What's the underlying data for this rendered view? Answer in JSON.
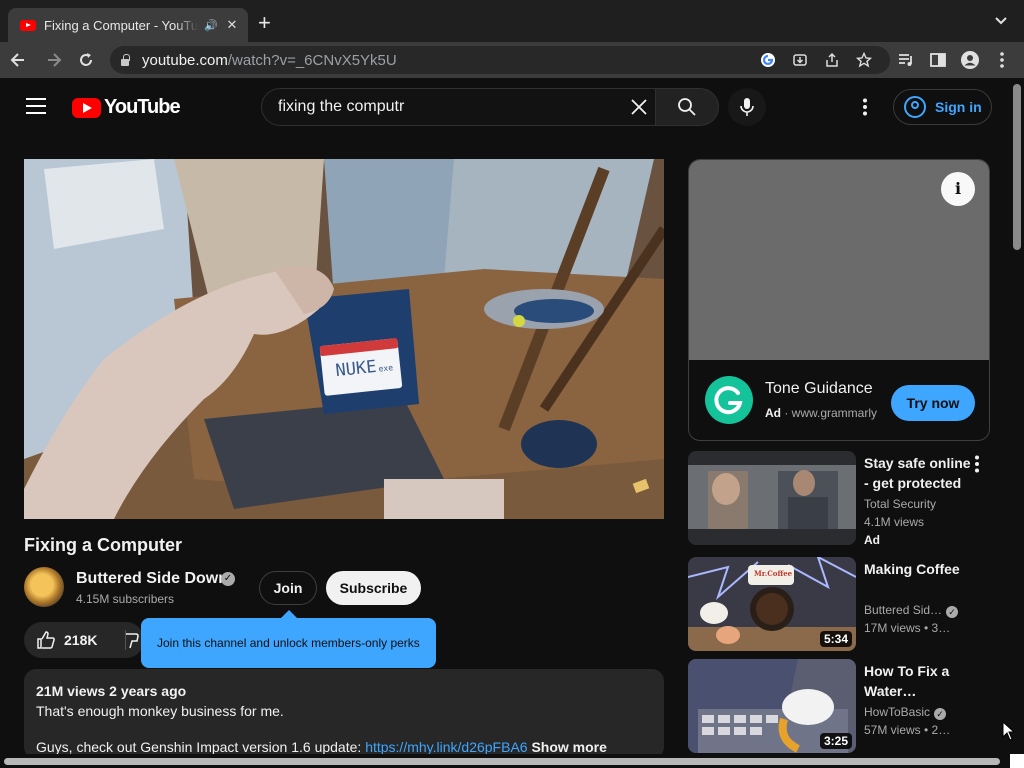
{
  "browser": {
    "tab_title": "Fixing a Computer - YouTube",
    "url_host": "youtube.com",
    "url_path": "/watch?v=_6CNvX5Yk5U"
  },
  "header": {
    "logo_text": "YouTube",
    "search_value": "fixing the computr",
    "sign_in_label": "Sign in"
  },
  "video": {
    "title": "Fixing a Computer",
    "channel": "Buttered Side Down",
    "subscribers": "4.15M subscribers",
    "join_label": "Join",
    "subscribe_label": "Subscribe",
    "likes": "218K",
    "join_tooltip": "Join this channel and unlock members-only perks",
    "views_date": "21M views  2 years ago",
    "description_line1": "That's enough monkey business for me.",
    "description_line3_text": "Guys, check out Genshin Impact version 1.6 update: ",
    "description_link": "https://mhy.link/d26pFBA6",
    "show_more": "Show more",
    "disk_label": "NUKE",
    "disk_ext": "exe"
  },
  "ad": {
    "title": "Tone Guidance",
    "badge": "Ad",
    "domain": "www.grammarly",
    "cta": "Try now",
    "logo_letter": "G",
    "info_glyph": "i"
  },
  "recommendations": [
    {
      "title": "Stay safe online - get protected",
      "channel": "Total Security",
      "views": "4.1M views",
      "ad_badge": "Ad",
      "duration": ""
    },
    {
      "title": "Making Coffee",
      "channel": "Buttered Sid…",
      "views": "17M views  • 3…",
      "duration": "5:34",
      "thumb_text": "Mr.Coffee"
    },
    {
      "title": "How To Fix a Water…",
      "channel": "HowToBasic",
      "views": "57M views  • 2…",
      "duration": "3:25"
    }
  ],
  "icons": {
    "speaker": "🔊",
    "close": "✕",
    "new_tab": "+",
    "verified": "✓"
  },
  "colors": {
    "brand_red": "#ff0000",
    "accent_blue": "#3ea6ff",
    "grammarly_green": "#15c39a"
  }
}
